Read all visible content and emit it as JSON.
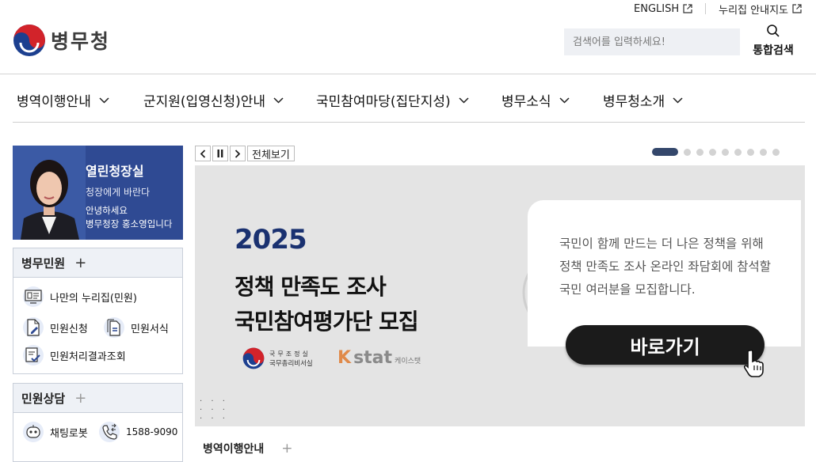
{
  "utility": {
    "english": "ENGLISH",
    "sitemap": "누리집 안내지도"
  },
  "header": {
    "logo_text": "병무청",
    "search_placeholder": "검색어를 입력하세요!",
    "total_search_label": "통합검색"
  },
  "gnb": {
    "items": [
      {
        "label": "병역이행안내"
      },
      {
        "label": "군지원(입영신청)안내"
      },
      {
        "label": "국민참여마당(집단지성)"
      },
      {
        "label": "병무소식"
      },
      {
        "label": "병무청소개"
      }
    ]
  },
  "ceo": {
    "title": "열린청장실",
    "subtitle": "청장에게 바란다",
    "greeting": "안녕하세요",
    "name_line": "병무청장 홍소영입니다"
  },
  "civil": {
    "title": "병무민원",
    "plus": "+",
    "items": [
      {
        "label": "나만의 누리집(민원)",
        "icon": "monitor-icon"
      },
      {
        "label": "민원신청",
        "icon": "document-edit-icon"
      },
      {
        "label": "민원서식",
        "icon": "documents-icon"
      },
      {
        "label": "민원처리결과조회",
        "icon": "result-check-icon"
      }
    ]
  },
  "consult": {
    "title": "민원상담",
    "plus": "+",
    "chatbot": "채팅로봇",
    "phone": "1588-9090"
  },
  "slider": {
    "view_all": "전체보기",
    "total_slides": 9,
    "active_slide": 1
  },
  "banner": {
    "year": "2025",
    "title_line1": "정책 만족도 조사",
    "title_line2": "국민참여평가단 모집",
    "org_line1": "국무조정실",
    "org_line2": "국무총리비서실",
    "kstat_k": "K",
    "kstat_s": "stat",
    "kstat_kr": "케이스탯",
    "desc_line1": "국민이 함께 만드는 더 나은 정책을 위해",
    "desc_line2": "정책 만족도 조사 온라인 좌담회에 참석할",
    "desc_line3": "국민 여러분을 모집합니다.",
    "button": "바로가기"
  },
  "section": {
    "title": "병역이행안내",
    "plus": "+"
  },
  "colors": {
    "brand_navy": "#1a3170",
    "ceo_bg": "#2f4a93",
    "active_dot": "#34476b",
    "banner_bg": "#e4e4e4"
  }
}
